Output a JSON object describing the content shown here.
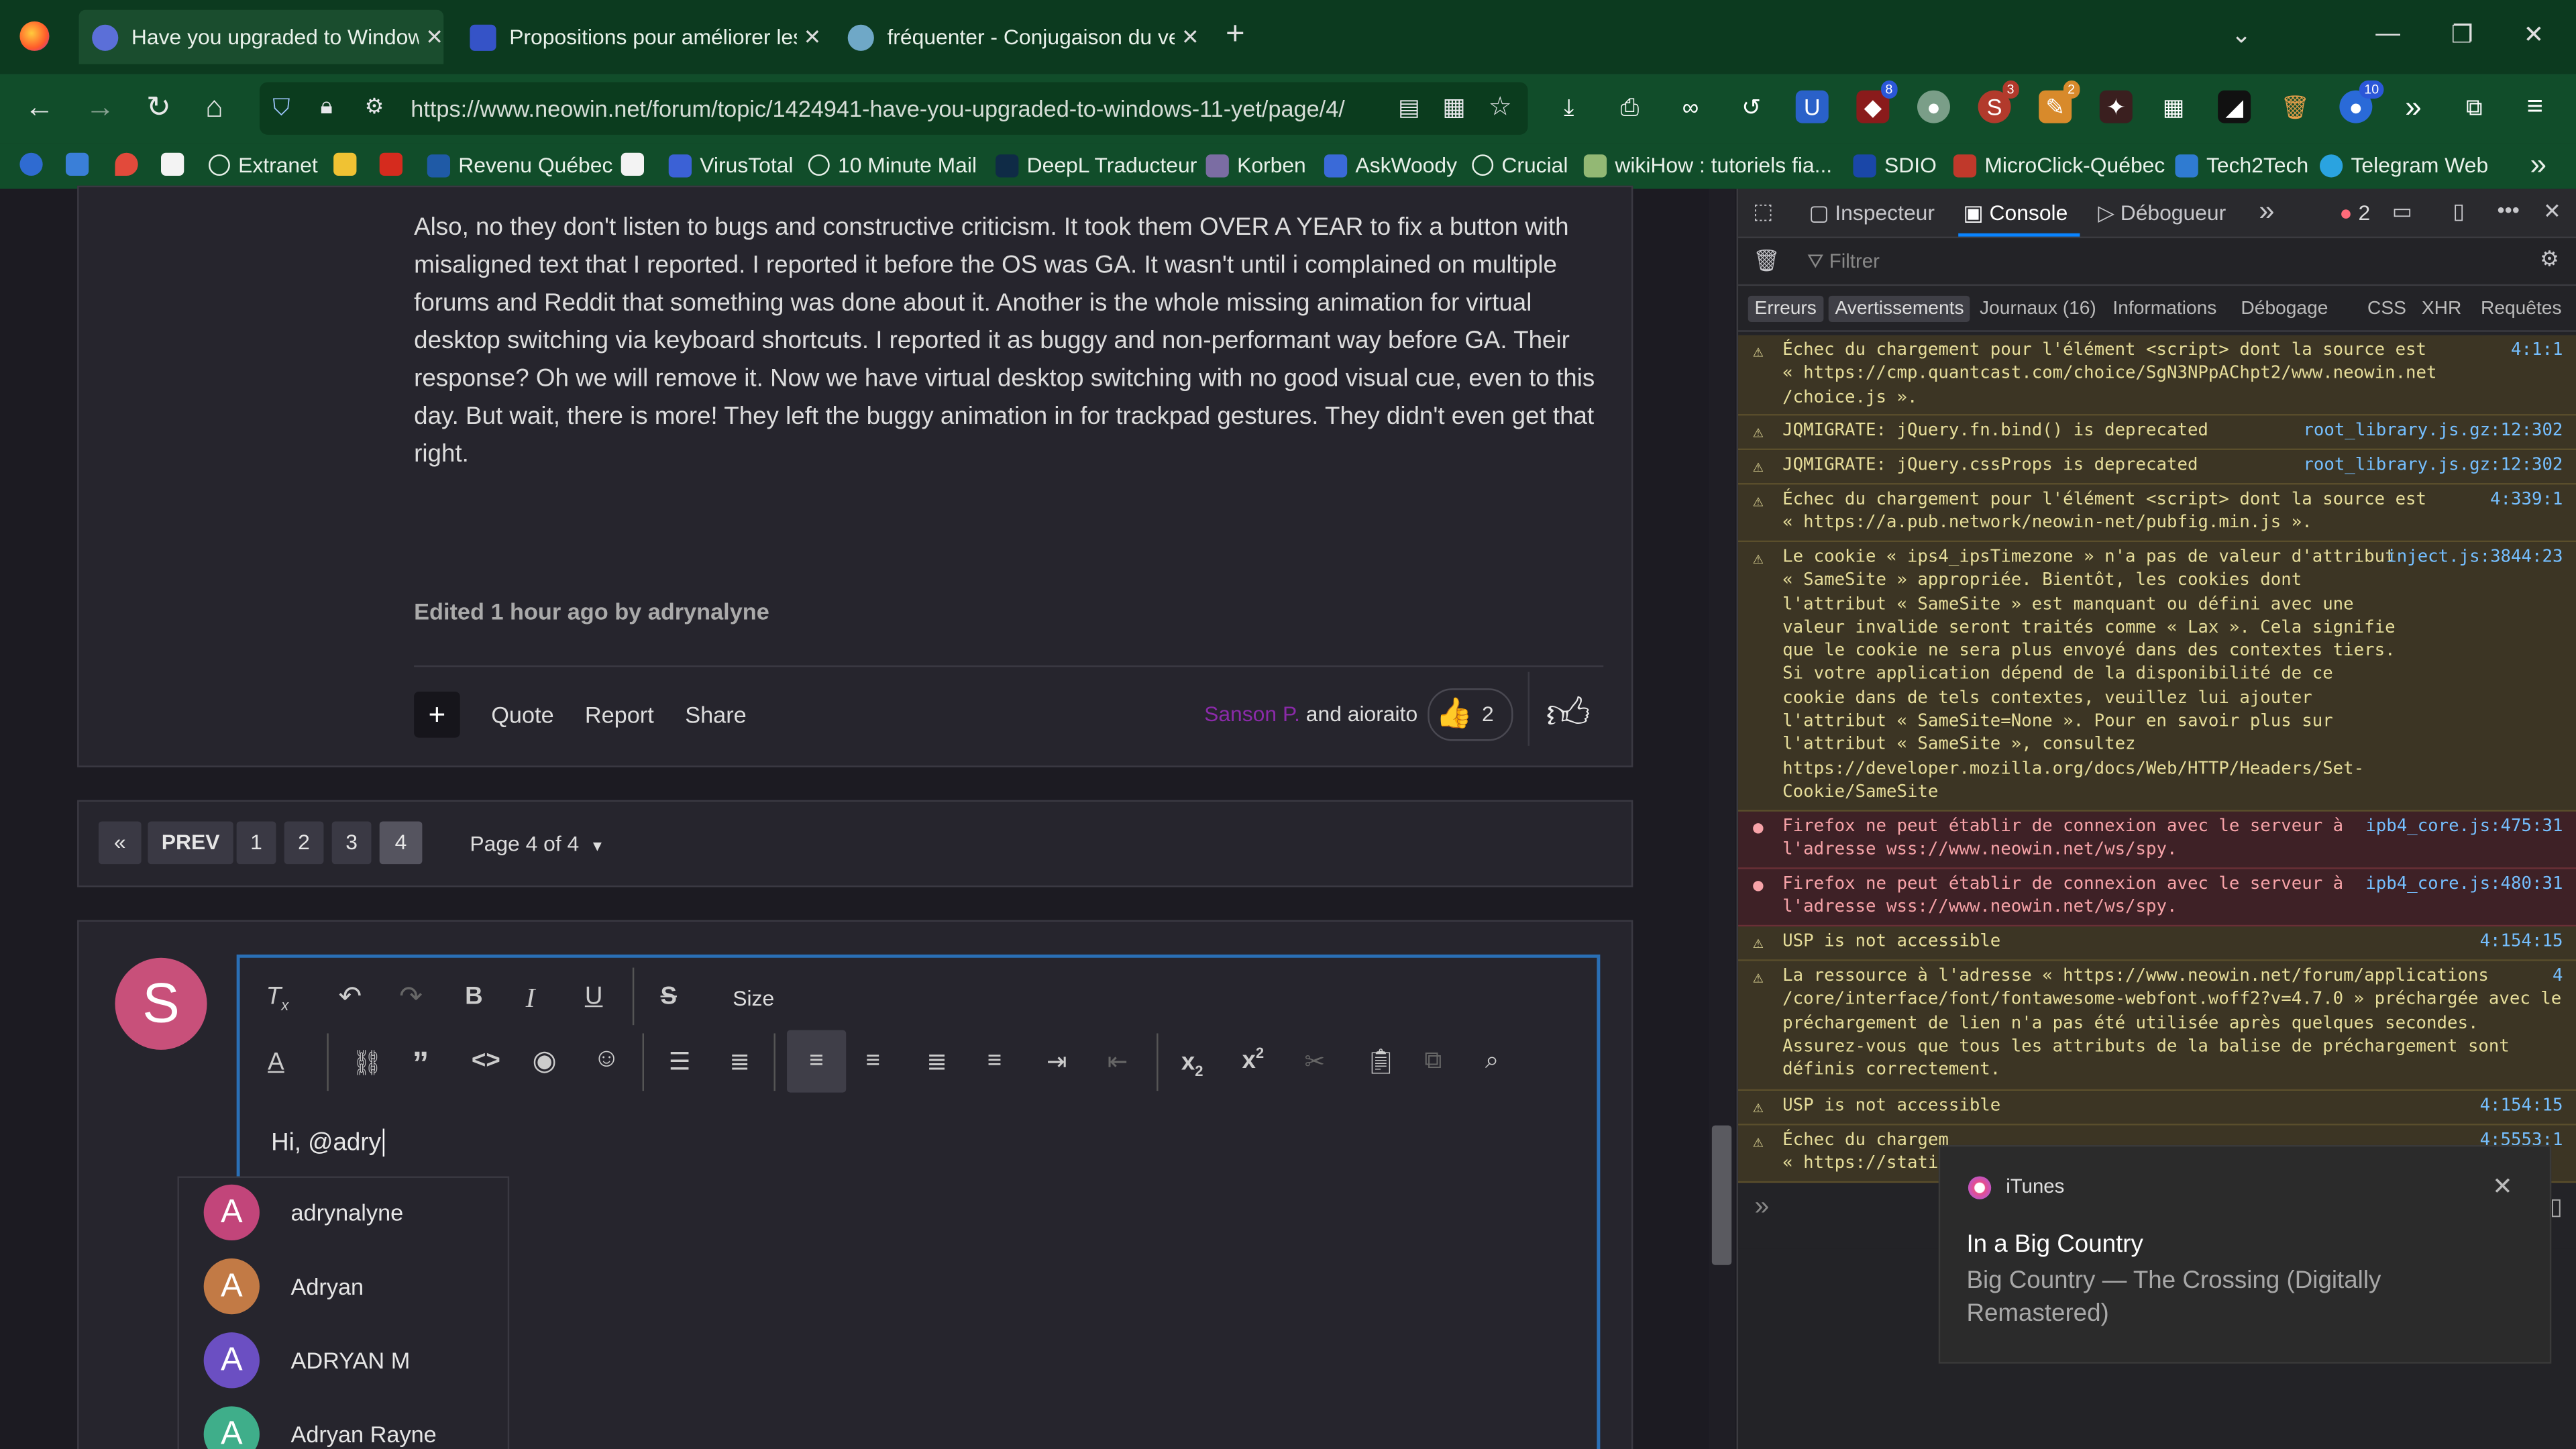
{
  "browser": {
    "tabs": [
      {
        "title": "Have you upgraded to Window",
        "active": true
      },
      {
        "title": "Propositions pour améliorer les",
        "active": false
      },
      {
        "title": "fréquenter - Conjugaison du ve",
        "active": false
      }
    ],
    "url": "https://www.neowin.net/forum/topic/1424941-have-you-upgraded-to-windows-11-yet/page/4/",
    "ext_badges": {
      "ublock": "8",
      "ext2": "3",
      "ext3": "2",
      "ext4": "10"
    },
    "bookmarks": [
      "Extranet",
      "Revenu Québec",
      "VirusTotal",
      "10 Minute Mail",
      "DeepL Traducteur",
      "Korben",
      "AskWoody",
      "Crucial",
      "wikiHow : tutoriels fia...",
      "SDIO",
      "MicroClick-Québec",
      "Tech2Tech",
      "Telegram Web"
    ]
  },
  "post": {
    "paragraph": "Also, no they don't listen to bugs and constructive criticism. It took them OVER A YEAR to fix a button with misaligned text that I reported. I reported it before the OS was GA. It wasn't until i complained on multiple forums and Reddit that something was done about it. Another is the whole missing animation for virtual desktop switching via keyboard shortcuts. I reported it as buggy and non-performant way before GA. Their response? Oh we will remove it. Now we have virtual desktop switching with no good visual cue, even to this day. But wait, there is more! They left the buggy animation in for trackpad gestures. They didn't even get that right.",
    "edited": "Edited 1 hour ago by adrynalyne",
    "actions": {
      "quote": "Quote",
      "report": "Report",
      "share": "Share"
    },
    "reaction_users": {
      "first": "Sanson P.",
      "rest": "and aioraito"
    },
    "reaction_count": "2"
  },
  "pagination": {
    "prev": "PREV",
    "pages": [
      "1",
      "2",
      "3",
      "4"
    ],
    "current": "4",
    "page_label": "Page 4 of 4"
  },
  "editor": {
    "avatar_letter": "S",
    "size_label": "Size",
    "text": "Hi, @adry",
    "mentions": [
      {
        "name": "adrynalyne",
        "letter": "A",
        "color": "#c2457a"
      },
      {
        "name": "Adryan",
        "letter": "A",
        "color": "#c27a45"
      },
      {
        "name": "ADRYAN M",
        "letter": "A",
        "color": "#6b4fc2"
      },
      {
        "name": "Adryan Rayne",
        "letter": "A",
        "color": "#3fae8a"
      }
    ]
  },
  "devtools": {
    "tabs": {
      "inspector": "Inspecteur",
      "console": "Console",
      "debugger": "Débogueur",
      "error_count": "2"
    },
    "filter_placeholder": "Filtrer",
    "filters": [
      "Erreurs",
      "Avertissements",
      "Journaux (16)",
      "Informations",
      "Débogage",
      "CSS",
      "XHR",
      "Requêtes"
    ],
    "logs": [
      {
        "type": "warn",
        "text": "Échec du chargement pour l'élément <script> dont la source est\n« https://cmp.quantcast.com/choice/SgN3NPpAChpt2/www.neowin.net\n/choice.js ».",
        "src": "4:1:1"
      },
      {
        "type": "warn",
        "text": "JQMIGRATE: jQuery.fn.bind() is deprecated",
        "src": "root_library.js.gz:12:302"
      },
      {
        "type": "warn",
        "text": "JQMIGRATE: jQuery.cssProps is deprecated",
        "src": "root_library.js.gz:12:302"
      },
      {
        "type": "warn",
        "text": "Échec du chargement pour l'élément <script> dont la source est\n« https://a.pub.network/neowin-net/pubfig.min.js ».",
        "src": "4:339:1"
      },
      {
        "type": "warn",
        "text": "Le cookie « ips4_ipsTimezone » n'a pas de valeur d'attribut\n« SameSite » appropriée. Bientôt, les cookies dont\nl'attribut « SameSite » est manquant ou défini avec une\nvaleur invalide seront traités comme « Lax ». Cela signifie\nque le cookie ne sera plus envoyé dans des contextes tiers.\nSi votre application dépend de la disponibilité de ce\ncookie dans de tels contextes, veuillez lui ajouter\nl'attribut « SameSite=None ». Pour en savoir plus sur\nl'attribut « SameSite », consultez\nhttps://developer.mozilla.org/docs/Web/HTTP/Headers/Set-\nCookie/SameSite",
        "src": "inject.js:3844:23"
      },
      {
        "type": "err",
        "text": "Firefox ne peut établir de connexion avec le serveur à\nl'adresse wss://www.neowin.net/ws/spy.",
        "src": "ipb4_core.js:475:31"
      },
      {
        "type": "err",
        "text": "Firefox ne peut établir de connexion avec le serveur à\nl'adresse wss://www.neowin.net/ws/spy.",
        "src": "ipb4_core.js:480:31"
      },
      {
        "type": "warn",
        "text": "USP is not accessible",
        "src": "4:154:15"
      },
      {
        "type": "warn",
        "text": "La ressource à l'adresse « https://www.neowin.net/forum/applications\n/core/interface/font/fontawesome-webfont.woff2?v=4.7.0 » préchargée avec le\npréchargement de lien n'a pas été utilisée après quelques secondes.\nAssurez-vous que tous les attributs de la balise de préchargement sont\ndéfinis correctement.",
        "src": "4"
      },
      {
        "type": "warn",
        "text": "USP is not accessible",
        "src": "4:154:15"
      },
      {
        "type": "warn",
        "text": "Échec du chargem\n« https://stati",
        "src": "4:5553:1"
      }
    ]
  },
  "notification": {
    "app": "iTunes",
    "title": "In a Big Country",
    "body": "Big Country — The Crossing (Digitally Remastered)"
  }
}
